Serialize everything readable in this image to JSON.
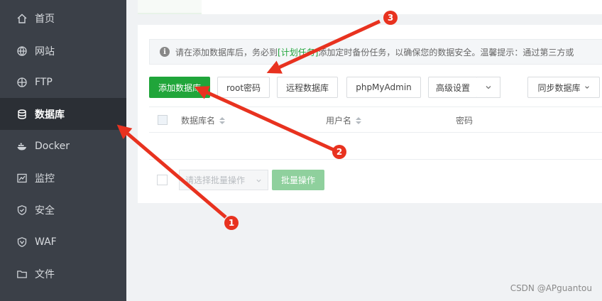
{
  "sidebar": {
    "items": [
      {
        "label": "首页",
        "icon": "home-icon"
      },
      {
        "label": "网站",
        "icon": "globe-icon"
      },
      {
        "label": "FTP",
        "icon": "ftp-globe-icon"
      },
      {
        "label": "数据库",
        "icon": "database-icon",
        "active": true
      },
      {
        "label": "Docker",
        "icon": "docker-icon"
      },
      {
        "label": "监控",
        "icon": "monitor-icon"
      },
      {
        "label": "安全",
        "icon": "shield-icon"
      },
      {
        "label": "WAF",
        "icon": "waf-shield-icon"
      },
      {
        "label": "文件",
        "icon": "folder-icon"
      }
    ]
  },
  "notice": {
    "prefix": "请在添加数据库后，务必到",
    "link": "[计划任务]",
    "suffix": "添加定时备份任务，以确保您的数据安全。温馨提示：通过第三方或"
  },
  "toolbar": {
    "add_db": "添加数据库",
    "root_pwd": "root密码",
    "remote_db": "远程数据库",
    "phpmyadmin": "phpMyAdmin",
    "advanced": "高级设置",
    "sync_db": "同步数据库"
  },
  "table": {
    "columns": [
      "数据库名",
      "用户名",
      "密码"
    ]
  },
  "footer": {
    "batch_placeholder": "请选择批量操作",
    "batch_button": "批量操作"
  },
  "annotations": [
    "1",
    "2",
    "3"
  ],
  "watermark": "CSDN @APguantou",
  "colors": {
    "accent": "#20a53a",
    "sidebar": "#3b4048",
    "arrow": "#e8321f"
  }
}
